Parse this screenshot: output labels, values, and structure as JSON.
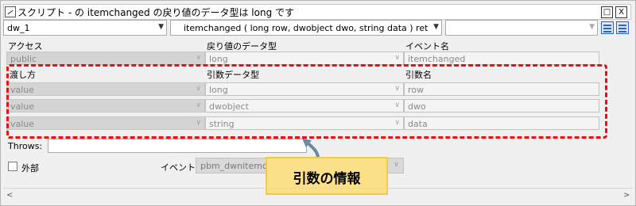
{
  "title": "スクリプト -  の itemchanged の戻り値のデータ型は long です",
  "window_buttons": {
    "restore": "□",
    "close": "X"
  },
  "toolbar": {
    "object_select": "dw_1",
    "event_select": "itemchanged ( long row, dwobject dwo, string data )  returns"
  },
  "headers": {
    "access": "アクセス",
    "return_type": "戻り値のデータ型",
    "event_name": "イベント名",
    "pass_by": "渡し方",
    "arg_type": "引数データ型",
    "arg_name": "引数名"
  },
  "signature": {
    "access": "public",
    "return_type": "long",
    "event_name": "itemchanged"
  },
  "arguments": [
    {
      "pass_by": "value",
      "type": "long",
      "name": "row"
    },
    {
      "pass_by": "value",
      "type": "dwobject",
      "name": "dwo"
    },
    {
      "pass_by": "value",
      "type": "string",
      "name": "data"
    }
  ],
  "throws_label": "Throws:",
  "external_label": "外部",
  "event_label": "イベント",
  "event_id_value": "pbm_dwnitemchange",
  "callout": "引数の情報",
  "colors": {
    "annotation_red": "#e81010",
    "callout_bg": "#fbe08a",
    "arrow": "#6a8aa8"
  }
}
